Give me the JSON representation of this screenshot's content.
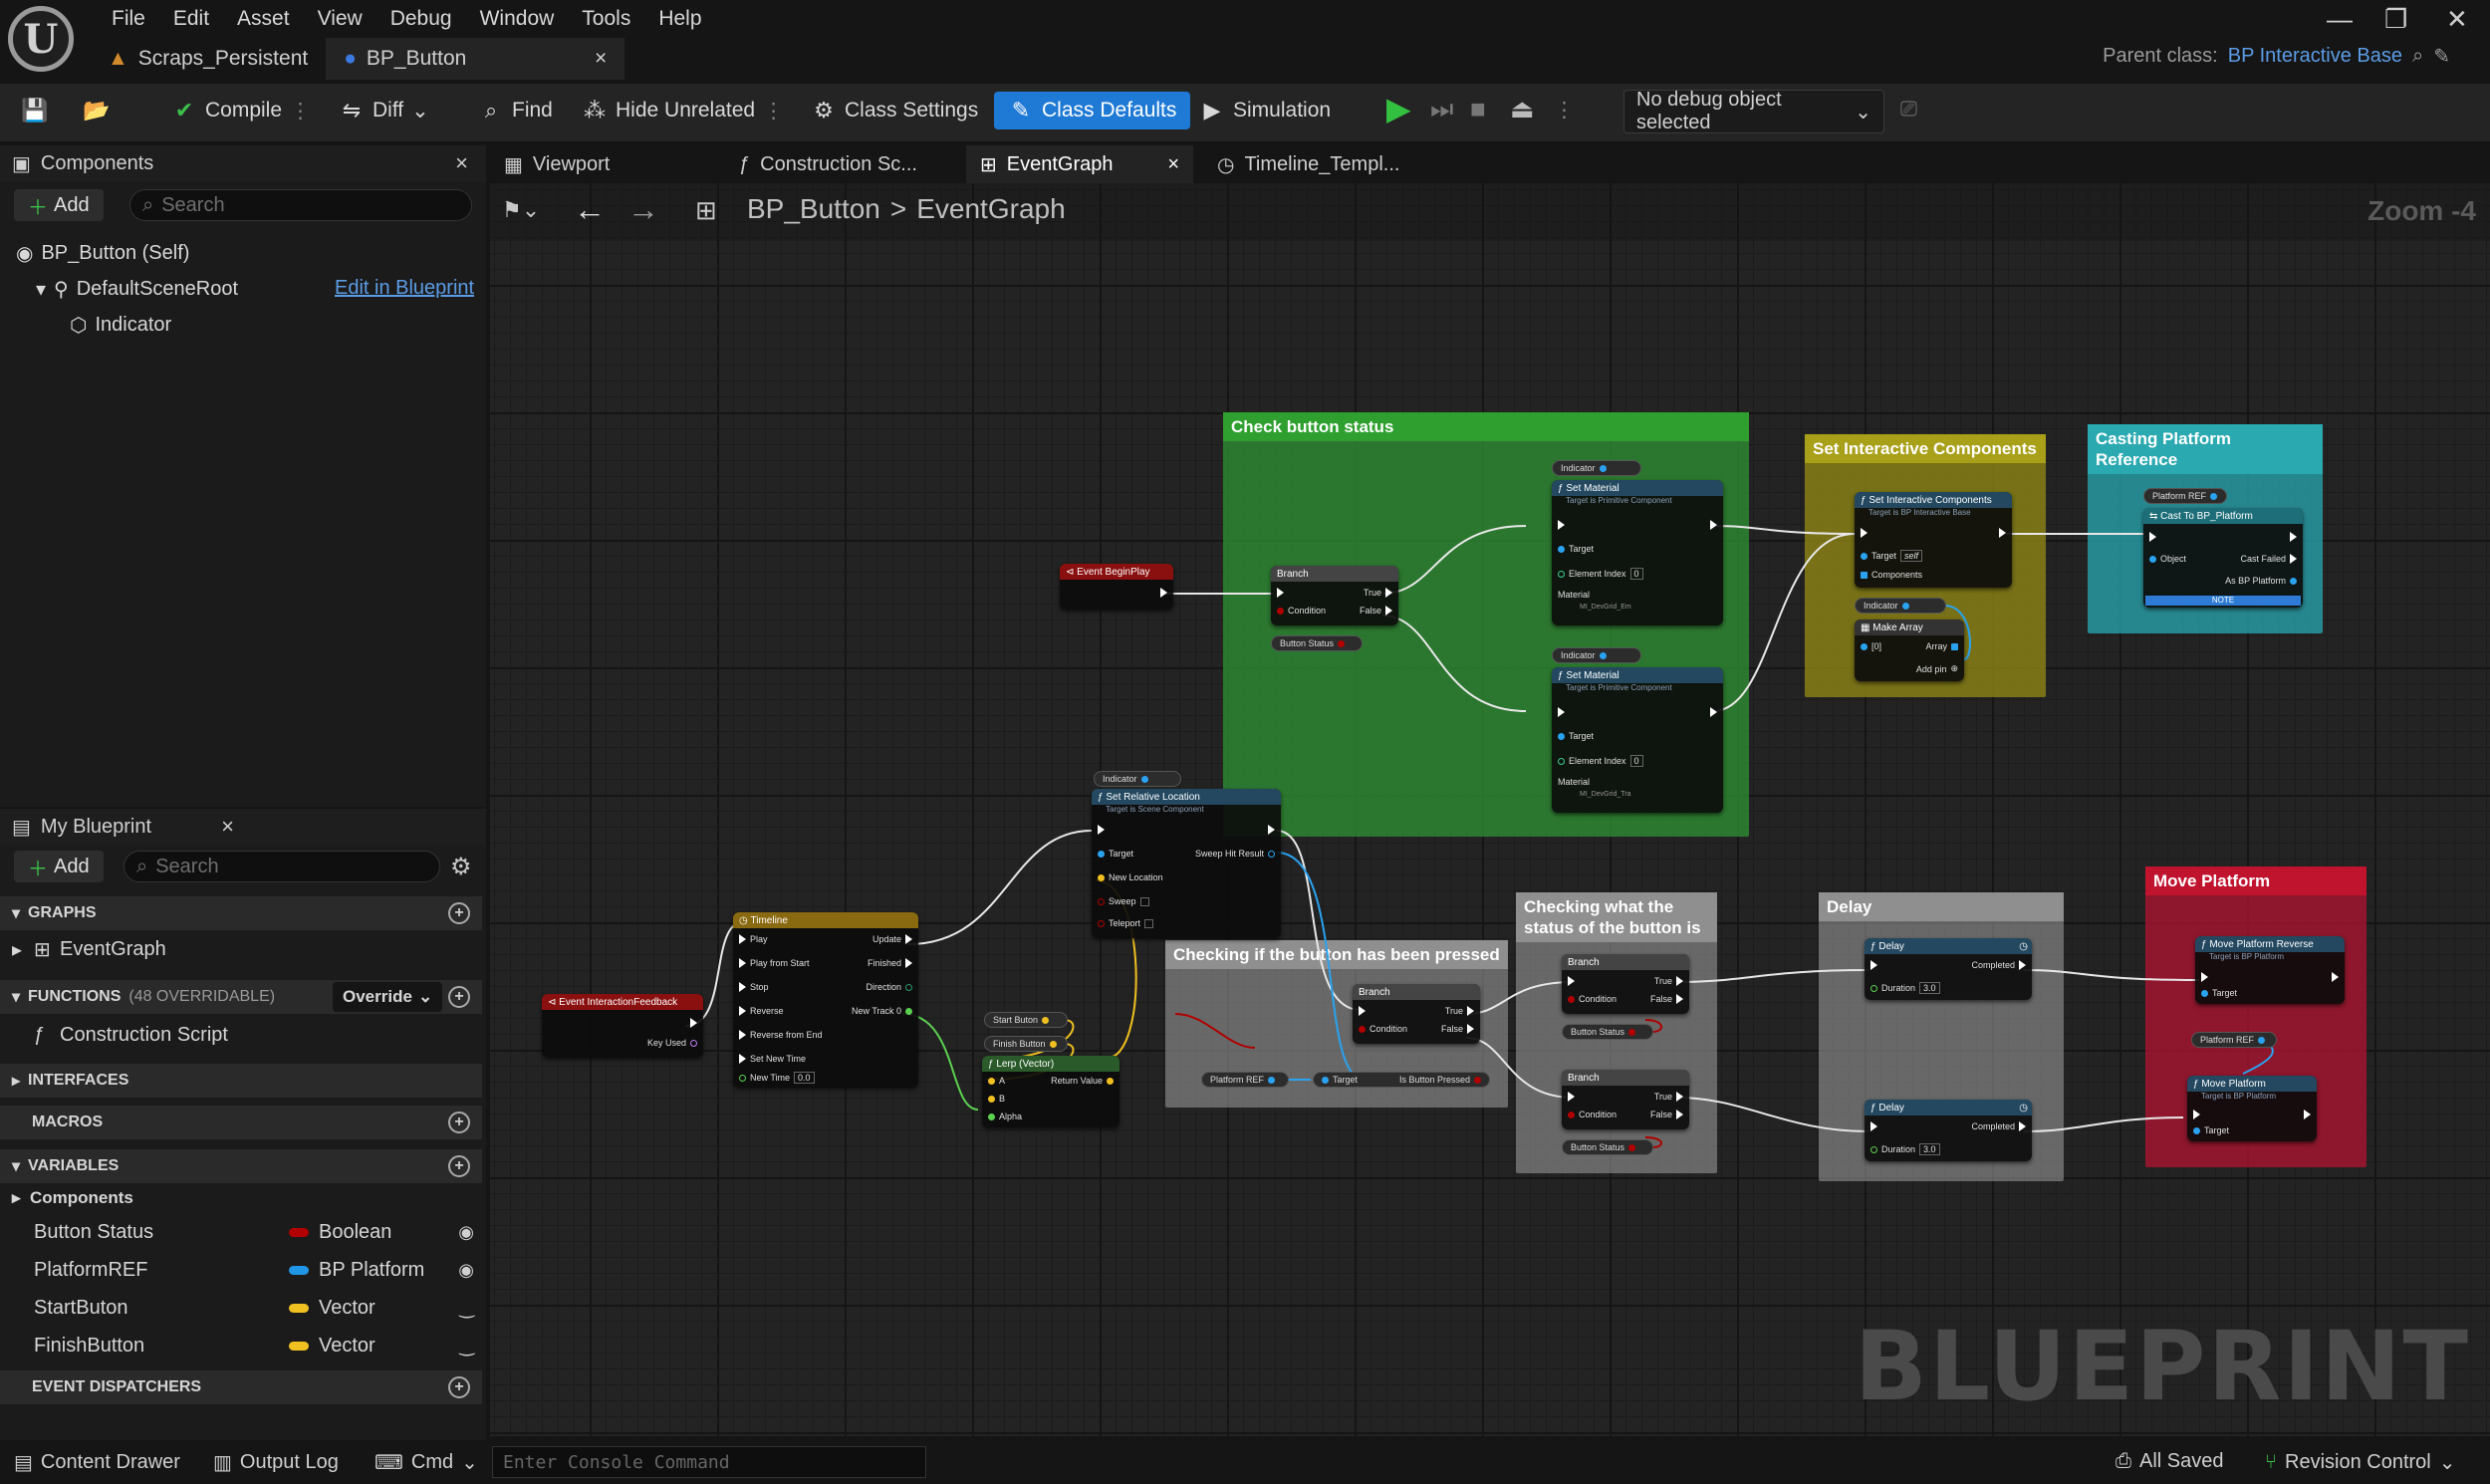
{
  "menu": [
    "File",
    "Edit",
    "Asset",
    "View",
    "Debug",
    "Window",
    "Tools",
    "Help"
  ],
  "doc_tabs": [
    {
      "label": "Scraps_Persistent"
    },
    {
      "label": "BP_Button"
    }
  ],
  "parent_class": {
    "label": "Parent class:",
    "value": "BP Interactive Base"
  },
  "toolbar": {
    "compile": "Compile",
    "diff": "Diff",
    "find": "Find",
    "hide_unrelated": "Hide Unrelated",
    "class_settings": "Class Settings",
    "class_defaults": "Class Defaults",
    "simulation": "Simulation",
    "debug_object": "No debug object selected"
  },
  "components": {
    "title": "Components",
    "add": "Add",
    "search_placeholder": "Search",
    "self": "BP_Button (Self)",
    "root": "DefaultSceneRoot",
    "edit_link": "Edit in Blueprint",
    "child": "Indicator"
  },
  "my_blueprint": {
    "title": "My Blueprint",
    "add": "Add",
    "search_placeholder": "Search",
    "graphs": "GRAPHS",
    "event_graph": "EventGraph",
    "functions": "FUNCTIONS",
    "functions_note": "(48 OVERRIDABLE)",
    "override": "Override",
    "construction_script": "Construction Script",
    "interfaces": "INTERFACES",
    "macros": "MACROS",
    "variables": "VARIABLES",
    "components_cat": "Components",
    "event_dispatchers": "EVENT DISPATCHERS",
    "vars": [
      {
        "name": "Button Status",
        "type": "Boolean",
        "color": "#b30000"
      },
      {
        "name": "PlatformREF",
        "type": "BP Platform",
        "color": "#2196e6"
      },
      {
        "name": "StartButon",
        "type": "Vector",
        "color": "#f0c020"
      },
      {
        "name": "FinishButton",
        "type": "Vector",
        "color": "#f0c020"
      }
    ]
  },
  "graph_tabs": [
    "Viewport",
    "Construction Sc...",
    "EventGraph",
    "Timeline_Templ..."
  ],
  "breadcrumb": {
    "root": "BP_Button",
    "sep": ">",
    "leaf": "EventGraph"
  },
  "zoom": "Zoom -4",
  "watermark": "BLUEPRINT",
  "comments": {
    "check": "Check button status",
    "set_ic": "Set Interactive Components",
    "casting": "Casting Platform Reference",
    "checking_pressed": "Checking if the button has been pressed",
    "checking_status": "Checking what the status of the button is",
    "delay": "Delay",
    "move": "Move Platform"
  },
  "nodes": {
    "begin_play": "Event BeginPlay",
    "branch": "Branch",
    "true": "True",
    "false": "False",
    "condition": "Condition",
    "button_status": "Button Status",
    "indicator": "Indicator",
    "set_material": "Set Material",
    "set_material_sub": "Target is Primitive Component",
    "target": "Target",
    "element_index": "Element Index",
    "element_index_val": "0",
    "material": "Material",
    "material_val_1": "MI_DevGrid_Em",
    "material_val_2": "MI_DevGrid_Tra",
    "set_ic": "Set Interactive Components",
    "set_ic_sub": "Target is BP Interactive Base",
    "self": "self",
    "components_pin": "Components",
    "make_array": "Make Array",
    "arr0": "[0]",
    "array": "Array",
    "add_pin": "Add pin",
    "platform_ref": "Platform REF",
    "cast": "Cast To BP_Platform",
    "object": "Object",
    "cast_failed": "Cast Failed",
    "as_bp": "As BP Platform",
    "note": "NOTE",
    "set_rel": "Set Relative Location",
    "set_rel_sub": "Target is Scene Component",
    "sweep_hit": "Sweep Hit Result",
    "new_location": "New Location",
    "sweep": "Sweep",
    "teleport": "Teleport",
    "timeline": "Timeline",
    "tl_pins": [
      "Play",
      "Play from Start",
      "Stop",
      "Reverse",
      "Reverse from End",
      "Set New Time",
      "New Time"
    ],
    "tl_out": [
      "Update",
      "Finished",
      "Direction",
      "New Track 0"
    ],
    "new_time_val": "0.0",
    "event_feedback": "Event InteractionFeedback",
    "key_used": "Key Used",
    "start_buton": "Start Buton",
    "finish_button": "Finish Button",
    "lerp": "Lerp (Vector)",
    "a": "A",
    "b": "B",
    "alpha": "Alpha",
    "return_value": "Return Value",
    "is_pressed": "Is Button Pressed",
    "delay": "Delay",
    "completed": "Completed",
    "duration": "Duration",
    "duration_val": "3.0",
    "move_rev": "Move Platform Reverse",
    "move_rev_sub": "Target is BP Platform",
    "move_plat": "Move Platform",
    "move_plat_sub": "Target is BP Platform"
  },
  "status": {
    "content_drawer": "Content Drawer",
    "output_log": "Output Log",
    "cmd": "Cmd",
    "console_placeholder": "Enter Console Command",
    "all_saved": "All Saved",
    "revision": "Revision Control"
  }
}
